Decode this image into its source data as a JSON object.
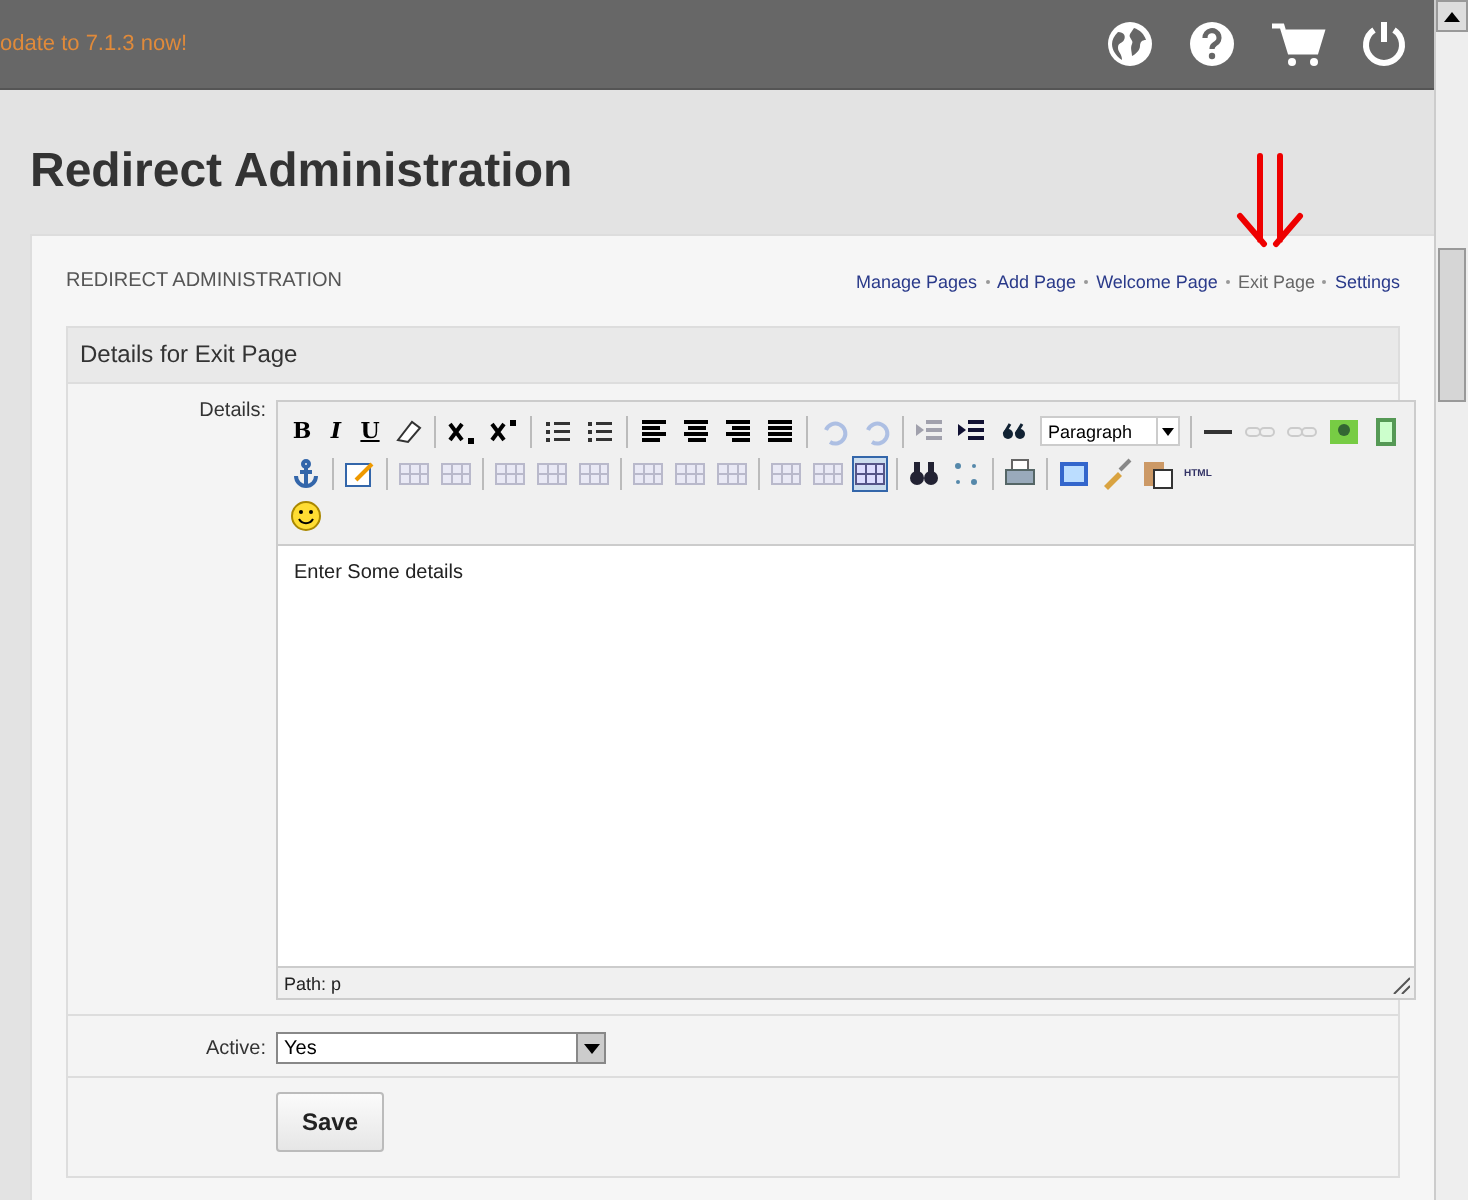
{
  "header": {
    "notice": "odate to 7.1.3 now!"
  },
  "page_title": "Redirect Administration",
  "panel": {
    "heading": "REDIRECT ADMINISTRATION",
    "nav": [
      {
        "label": "Manage Pages",
        "selected": false
      },
      {
        "label": "Add Page",
        "selected": false
      },
      {
        "label": "Welcome Page",
        "selected": false
      },
      {
        "label": "Exit Page",
        "selected": true
      },
      {
        "label": "Settings",
        "selected": false
      }
    ]
  },
  "form": {
    "title": "Details for Exit Page",
    "details_label": "Details:",
    "editor": {
      "toolbar_labels": [
        "B",
        "I",
        "U",
        "HTML"
      ],
      "format": "Paragraph",
      "content": "Enter Some details",
      "path": "Path: p"
    },
    "active_label": "Active:",
    "active_value": "Yes",
    "save": "Save"
  }
}
